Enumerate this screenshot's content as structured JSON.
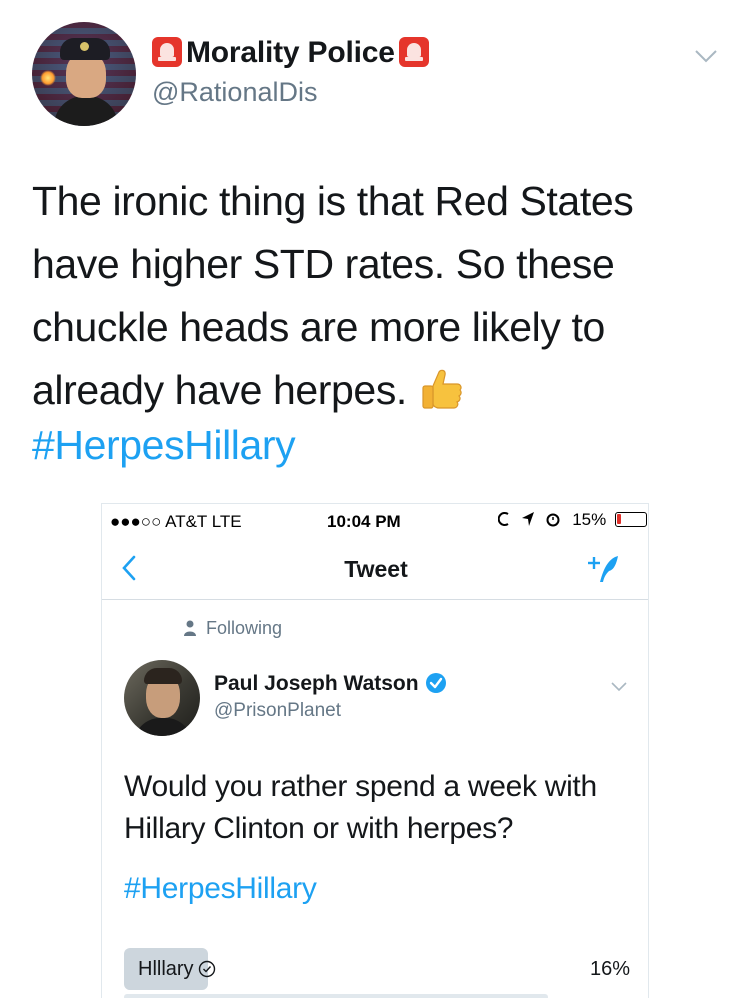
{
  "outer_tweet": {
    "display_name": "Morality Police",
    "handle": "@RationalDis",
    "text_lines": [
      "The ironic thing is that Red States",
      "have higher STD rates. So these",
      "chuckle heads are more likely to",
      "already have herpes."
    ],
    "hashtag": "#HerpesHillary"
  },
  "embedded_screenshot": {
    "status_bar": {
      "carrier": "●●●○○ AT&T  LTE",
      "time": "10:04 PM",
      "battery": "15%",
      "battery_level": 0.15,
      "battery_color": "#e0302a"
    },
    "nav": {
      "title": "Tweet"
    },
    "following_label": "Following",
    "inner_tweet": {
      "display_name": "Paul Joseph Watson",
      "handle": "@PrisonPlanet",
      "text_lines": [
        "Would you rather spend a week with",
        "Hillary Clinton or with herpes?"
      ],
      "hashtag": "#HerpesHillary"
    },
    "poll": {
      "options": [
        {
          "label": "Hlllary",
          "percent": "16%",
          "fraction": 0.16,
          "selected": true
        }
      ]
    }
  },
  "colors": {
    "link": "#1da1f2",
    "secondary_text": "#657786",
    "siren_red": "#e5352b",
    "poll_bar": "#cdd6dd"
  },
  "icons": [
    "siren-icon",
    "chevron-down-icon",
    "thumbs-up-icon",
    "back-arrow-icon",
    "compose-tweet-icon",
    "person-icon",
    "verified-badge-icon",
    "checkmark-circle-icon",
    "battery-icon"
  ]
}
